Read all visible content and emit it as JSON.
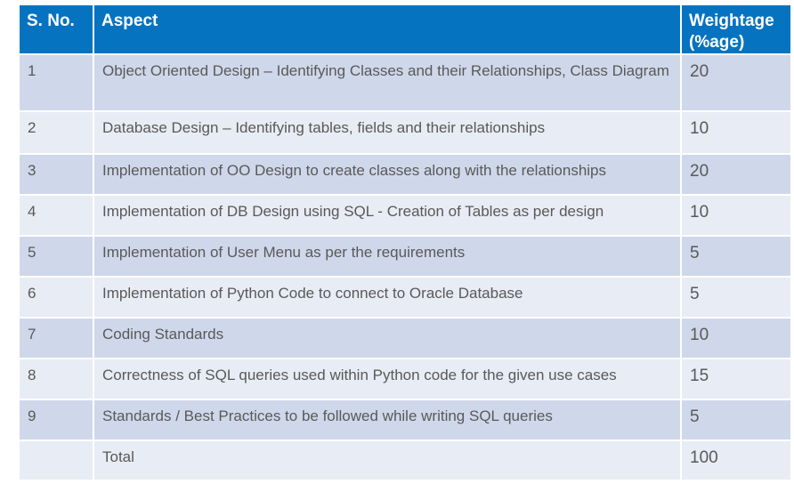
{
  "table": {
    "headers": {
      "sno": "S. No.",
      "aspect": "Aspect",
      "weightage": "Weightage (%age)"
    },
    "rows": [
      {
        "sno": "1",
        "aspect": "Object Oriented Design – Identifying Classes and their Relationships, Class Diagram",
        "weightage": "20"
      },
      {
        "sno": "2",
        "aspect": "Database Design – Identifying tables, fields and their relationships",
        "weightage": "10"
      },
      {
        "sno": "3",
        "aspect": "Implementation of OO Design to create classes along with the relationships",
        "weightage": "20"
      },
      {
        "sno": "4",
        "aspect": "Implementation of DB Design using SQL - Creation of Tables as per design",
        "weightage": "10"
      },
      {
        "sno": "5",
        "aspect": "Implementation of User Menu as per the requirements",
        "weightage": "5"
      },
      {
        "sno": "6",
        "aspect": "Implementation of Python Code to connect to Oracle Database",
        "weightage": "5"
      },
      {
        "sno": "7",
        "aspect": "Coding Standards",
        "weightage": "10"
      },
      {
        "sno": "8",
        "aspect": "Correctness of SQL queries used within Python code for the given use cases",
        "weightage": "15"
      },
      {
        "sno": "9",
        "aspect": "Standards / Best Practices to be followed while writing SQL queries",
        "weightage": "5"
      },
      {
        "sno": "",
        "aspect": "Total",
        "weightage": "100"
      }
    ]
  },
  "colors": {
    "header_bg": "#0673c0",
    "row_odd_bg": "#cfd8ea",
    "row_even_bg": "#e8ecf5",
    "body_text": "#595959"
  }
}
